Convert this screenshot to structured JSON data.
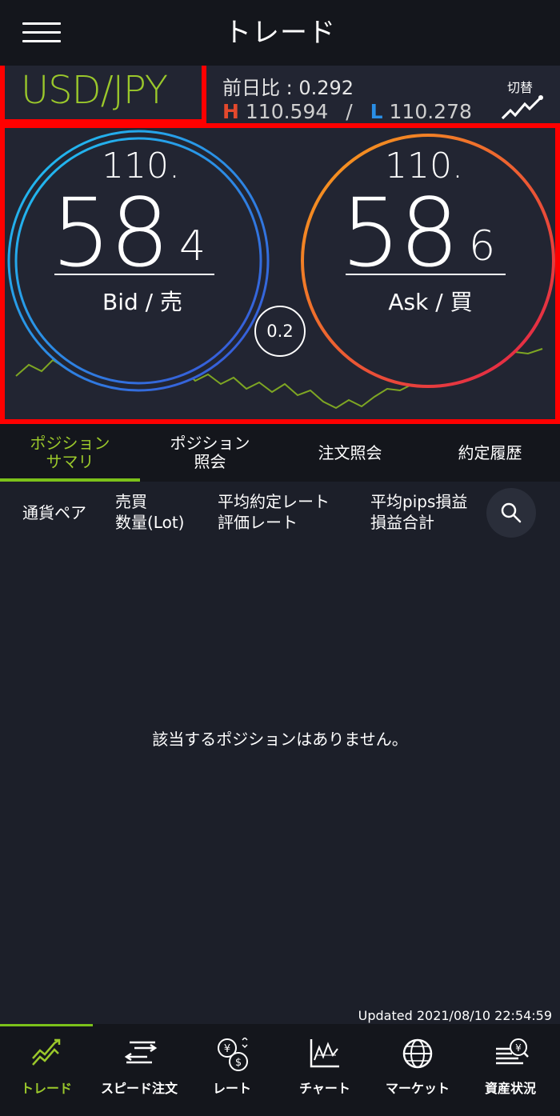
{
  "header": {
    "title": "トレード",
    "menu_icon": "hamburger-menu-icon"
  },
  "rate": {
    "pair": "USD/JPY",
    "prev_day_label": "前日比 : ",
    "prev_day_value": "0.292",
    "high_label": "H",
    "high_value": "110.594",
    "low_label": "L",
    "low_value": "110.278",
    "switch_label": "切替",
    "switch_icon": "chart-switch-icon"
  },
  "bid": {
    "int_part": "110.",
    "pips": "58",
    "frac": "4",
    "label": "Bid / 売"
  },
  "ask": {
    "int_part": "110.",
    "pips": "58",
    "frac": "6",
    "label": "Ask / 買"
  },
  "spread": "0.2",
  "tabs": [
    {
      "label_line1": "ポジション",
      "label_line2": "サマリ",
      "active": true
    },
    {
      "label_line1": "ポジション",
      "label_line2": "照会",
      "active": false
    },
    {
      "label_line1": "注文照会",
      "label_line2": "",
      "active": false
    },
    {
      "label_line1": "約定履歴",
      "label_line2": "",
      "active": false
    }
  ],
  "columns": {
    "pair": "通貨ペア",
    "side_line1": "売買",
    "side_line2": "数量(Lot)",
    "rate_line1": "平均約定レート",
    "rate_line2": "評価レート",
    "pl_line1": "平均pips損益",
    "pl_line2": "損益合計"
  },
  "empty_message": "該当するポジションはありません。",
  "updated": "Updated  2021/08/10 22:54:59",
  "bottom_nav": [
    {
      "label": "トレード",
      "icon": "trade-icon",
      "active": true
    },
    {
      "label": "スピード注文",
      "icon": "speed-order-icon",
      "active": false
    },
    {
      "label": "レート",
      "icon": "rate-icon",
      "active": false
    },
    {
      "label": "チャート",
      "icon": "chart-icon",
      "active": false
    },
    {
      "label": "マーケット",
      "icon": "market-globe-icon",
      "active": false
    },
    {
      "label": "資産状況",
      "icon": "assets-icon",
      "active": false
    }
  ],
  "colors": {
    "accent_green": "#9bc82b",
    "highlight_red": "#ff0000",
    "high_red": "#e4492d",
    "low_blue": "#2a8fe6"
  }
}
